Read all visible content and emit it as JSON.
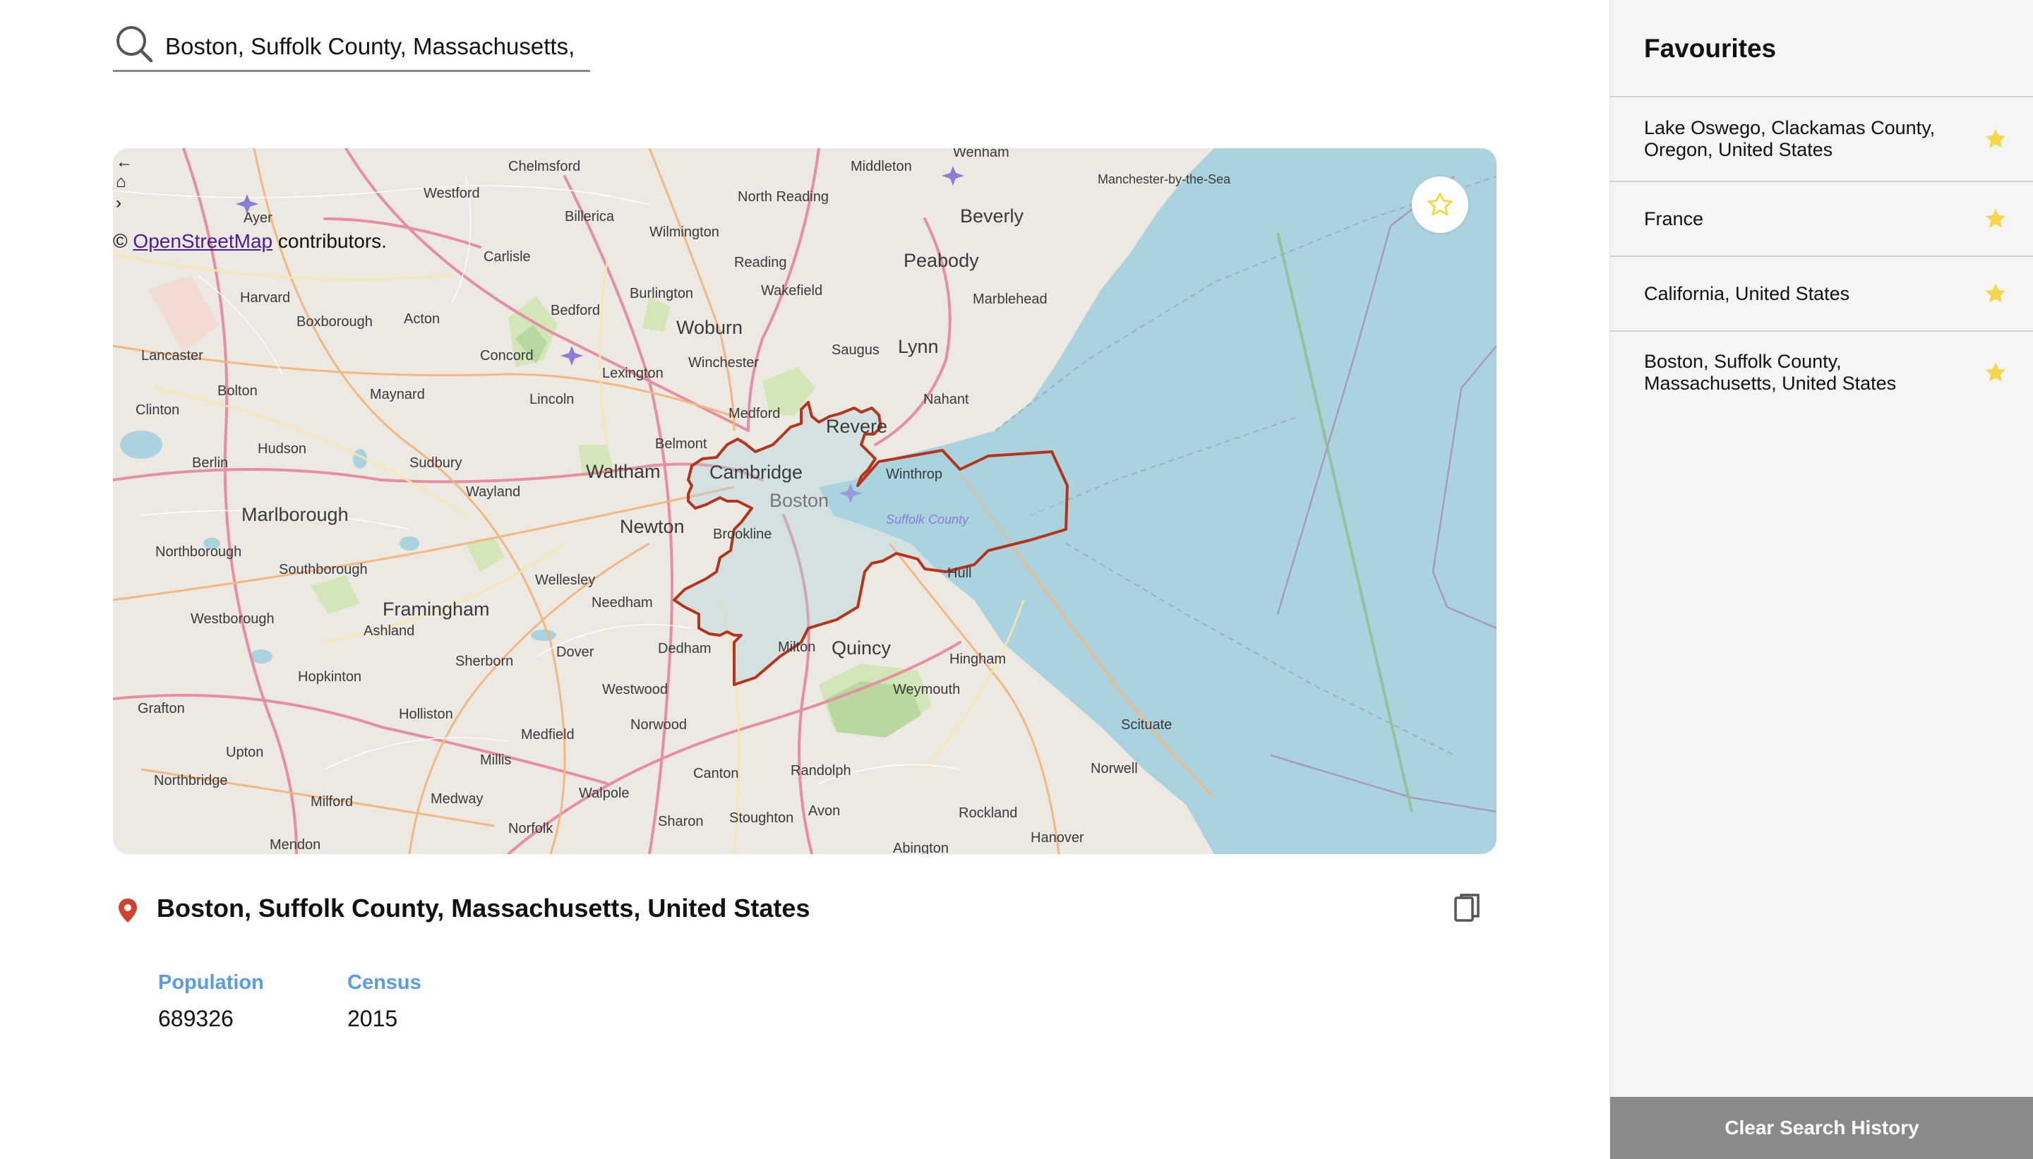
{
  "search": {
    "value": "Boston, Suffolk County, Massachusetts,",
    "icon": "search-icon"
  },
  "map": {
    "controls": [
      "←",
      "⌂",
      "›"
    ],
    "attribution_prefix": "©",
    "attribution_link": "OpenStreetMap",
    "attribution_suffix": "contributors.",
    "favourite_icon": "star-outline-icon",
    "places": [
      "Chelmsford",
      "Westford",
      "Ayer",
      "Billerica",
      "Wilmington",
      "North Reading",
      "Middleton",
      "Wenham",
      "Beverly",
      "Manchester-by-the-Sea",
      "Carlisle",
      "Reading",
      "Peabody",
      "Harvard",
      "Boxborough",
      "Acton",
      "Bedford",
      "Burlington",
      "Wakefield",
      "Woburn",
      "Marblehead",
      "Lancaster",
      "Concord",
      "Lexington",
      "Winchester",
      "Saugus",
      "Lynn",
      "Bolton",
      "Maynard",
      "Lincoln",
      "Nahant",
      "Clinton",
      "Medford",
      "Revere",
      "Berlin",
      "Hudson",
      "Sudbury",
      "Belmont",
      "Waltham",
      "Cambridge",
      "Winthrop",
      "Wayland",
      "Boston",
      "Marlborough",
      "Newton",
      "Brookline",
      "Suffolk County",
      "Northborough",
      "Southborough",
      "Wellesley",
      "Hull",
      "Framingham",
      "Needham",
      "Westborough",
      "Ashland",
      "Dover",
      "Dedham",
      "Milton",
      "Quincy",
      "Hingham",
      "Sherborn",
      "Westwood",
      "Hopkinton",
      "Weymouth",
      "Grafton",
      "Holliston",
      "Norwood",
      "Scituate",
      "Medfield",
      "Millis",
      "Upton",
      "Canton",
      "Randolph",
      "Norwell",
      "Northbridge",
      "Milford",
      "Medway",
      "Walpole",
      "Avon",
      "Rockland",
      "Sharon",
      "Stoughton",
      "Norfolk",
      "Hanover",
      "Mendon",
      "Abington"
    ]
  },
  "result": {
    "pin_icon": "location-pin-icon",
    "title": "Boston, Suffolk County, Massachusetts, United States",
    "copy_icon": "copy-icon",
    "stats": [
      {
        "label": "Population",
        "value": "689326"
      },
      {
        "label": "Census",
        "value": "2015"
      }
    ]
  },
  "sidebar": {
    "title": "Favourites",
    "items": [
      {
        "name": "Lake Oswego, Clackamas County, Oregon, United States"
      },
      {
        "name": "France"
      },
      {
        "name": "California, United States"
      },
      {
        "name": "Boston, Suffolk County, Massachusetts, United States"
      }
    ],
    "clear_label": "Clear Search History"
  },
  "colors": {
    "accent_label": "#5b9be0",
    "star": "#f5d84a",
    "boundary": "#b5341c",
    "water": "#aad3df",
    "clear_button": "#8a8a8a"
  }
}
